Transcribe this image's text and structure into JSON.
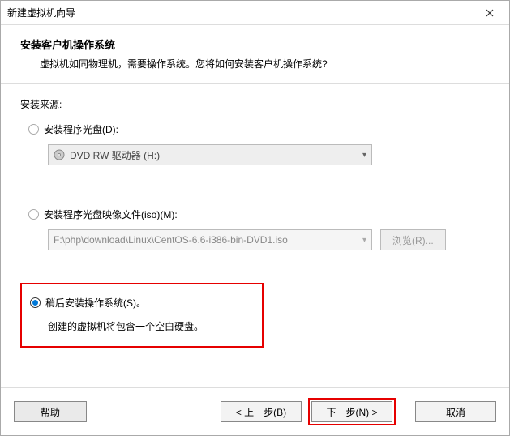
{
  "titlebar": {
    "title": "新建虚拟机向导"
  },
  "header": {
    "title": "安装客户机操作系统",
    "subtitle": "虚拟机如同物理机，需要操作系统。您将如何安装客户机操作系统?"
  },
  "content": {
    "source_label": "安装来源:",
    "opt1": {
      "label": "安装程序光盘(D):",
      "dropdown": "DVD RW 驱动器 (H:)"
    },
    "opt2": {
      "label": "安装程序光盘映像文件(iso)(M):",
      "path": "F:\\php\\download\\Linux\\CentOS-6.6-i386-bin-DVD1.iso",
      "browse": "浏览(R)..."
    },
    "opt3": {
      "label": "稍后安装操作系统(S)。",
      "note": "创建的虚拟机将包含一个空白硬盘。"
    }
  },
  "footer": {
    "help": "帮助",
    "back": "< 上一步(B)",
    "next": "下一步(N) >",
    "cancel": "取消"
  }
}
